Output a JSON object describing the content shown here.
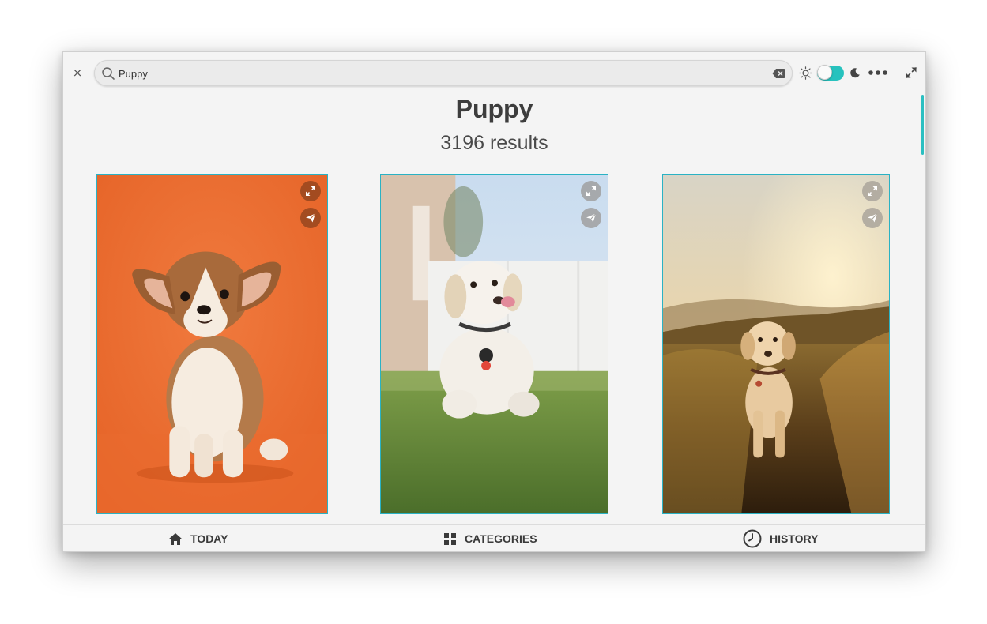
{
  "search": {
    "value": "Puppy",
    "search_icon": "search-icon",
    "clear_icon": "backspace-clear-icon"
  },
  "header": {
    "close_label": "×",
    "theme_light_icon": "sun-icon",
    "theme_dark_icon": "moon-icon",
    "theme_toggle_state": "light",
    "menu_icon": "more-horizontal-icon",
    "fullscreen_icon": "fullscreen-icon"
  },
  "main": {
    "title": "Puppy",
    "result_count": "3196 results"
  },
  "photos": [
    {
      "subject": "corgi-puppy-orange-background",
      "actions": [
        "expand-icon",
        "send-icon"
      ]
    },
    {
      "subject": "labrador-puppy-on-grass",
      "actions": [
        "expand-icon",
        "send-icon"
      ]
    },
    {
      "subject": "labrador-in-sunset-field",
      "actions": [
        "expand-icon",
        "send-icon"
      ]
    }
  ],
  "bottom_nav": {
    "items": [
      {
        "label": "TODAY",
        "icon": "home-icon"
      },
      {
        "label": "CATEGORIES",
        "icon": "grid-icon"
      },
      {
        "label": "HISTORY",
        "icon": "clock-icon"
      }
    ]
  },
  "colors": {
    "accent": "#27c2be",
    "card_border": "#2ab2c4",
    "window_bg": "#f4f4f4",
    "text_dark": "#3d3d3d"
  }
}
